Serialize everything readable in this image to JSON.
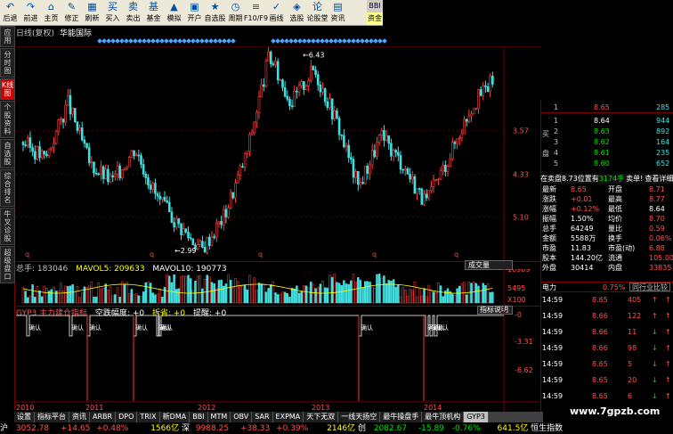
{
  "toolbar": {
    "buttons": [
      {
        "icon": "↶",
        "label": "后退",
        "name": "back"
      },
      {
        "icon": "↷",
        "label": "前进",
        "name": "forward"
      },
      {
        "icon": "⌂",
        "label": "主页",
        "name": "home"
      },
      {
        "icon": "✎",
        "label": "修正",
        "name": "edit"
      },
      {
        "icon": "▦",
        "label": "刷新",
        "name": "refresh"
      },
      {
        "icon": "买",
        "label": "买入",
        "name": "buy"
      },
      {
        "icon": "卖",
        "label": "卖出",
        "name": "sell"
      },
      {
        "icon": "基",
        "label": "基金",
        "name": "fund"
      },
      {
        "icon": "▲",
        "label": "模拟",
        "name": "simulate"
      },
      {
        "icon": "▣",
        "label": "开户",
        "name": "open-account"
      },
      {
        "icon": "★",
        "label": "自选股",
        "name": "watchlist"
      },
      {
        "icon": "◷",
        "label": "周期",
        "name": "period"
      },
      {
        "icon": "≡",
        "label": "F10/F9",
        "name": "f10"
      },
      {
        "icon": "✓",
        "label": "画线",
        "name": "draw"
      },
      {
        "icon": "◈",
        "label": "选股",
        "name": "stock-pick"
      },
      {
        "icon": "论",
        "label": "论股堂",
        "name": "forum"
      },
      {
        "icon": "▤",
        "label": "资讯",
        "name": "news"
      }
    ],
    "corner": "BBI",
    "top_right": "资金"
  },
  "sidebar": [
    "应用",
    "分时图",
    "K线图",
    "个股资料",
    "自选股",
    "综合排名",
    "牛叉诊股",
    "超级盘口"
  ],
  "chart_title": {
    "name": "日线(复权)",
    "stock": "华能国际"
  },
  "price_axis": [
    "5.10",
    "4.33",
    "3.57"
  ],
  "high_label": "6.43",
  "low_label": "2.99",
  "volume_header": {
    "total": "总手: 183046",
    "mavol5": "MAVOL5: 209633",
    "mavol10": "MAVOL10: 190773",
    "button": "成交量"
  },
  "volume_axis": [
    "10989",
    "5495",
    "X100"
  ],
  "indicator_header": {
    "name": "GYP3 主力建仓指标",
    "a": "空跌幅度: +0",
    "b": "拆省: +0",
    "c": "提醒: +0",
    "button": "指标说明"
  },
  "indicator_axis": [
    "-0",
    "-3.31",
    "-6.62"
  ],
  "indicator_markers": [
    "确认",
    "确认",
    "确认",
    "确认",
    "确认",
    "确认",
    "确认",
    "确认",
    "确认",
    "确认"
  ],
  "years": [
    "2010",
    "2011",
    "2012",
    "2013",
    "2014"
  ],
  "order_book": {
    "sell": [
      {
        "lvl": "1",
        "p": "8.65",
        "v": "285"
      }
    ],
    "buy": [
      {
        "lvl": "1",
        "p": "8.64",
        "v": "944"
      },
      {
        "lvl": "2",
        "p": "8.63",
        "v": "892"
      },
      {
        "lvl": "3",
        "p": "8.62",
        "v": "164"
      },
      {
        "lvl": "4",
        "p": "8.61",
        "v": "235"
      },
      {
        "lvl": "5",
        "p": "8.60",
        "v": "652"
      }
    ],
    "side_a": "买",
    "side_b": "盘"
  },
  "order_note": {
    "a": "在卖盘8.73位置有",
    "b": "3174手",
    "c": "卖单!",
    "d": "查看详细"
  },
  "quote": [
    [
      "最新",
      "8.65",
      "开盘",
      "8.71"
    ],
    [
      "涨跌",
      "+0.01",
      "最高",
      "8.77"
    ],
    [
      "涨幅",
      "+0.12%",
      "最低",
      "8.64"
    ],
    [
      "振幅",
      "1.50%",
      "均价",
      "8.70"
    ],
    [
      "总手",
      "64249",
      "量比",
      "0.59"
    ],
    [
      "金额",
      "5588万",
      "换手",
      "0.06%"
    ],
    [
      "市盈",
      "11.83",
      "市盈(动)",
      "6.88"
    ],
    [
      "股本",
      "144.20亿",
      "流通",
      "105.00亿"
    ],
    [
      "外盘",
      "30414",
      "内盘",
      "33835"
    ]
  ],
  "industry": {
    "name": "电力",
    "pct": "0.75%",
    "link": "同行业比较"
  },
  "trades": [
    [
      "14:59",
      "8.65",
      "405",
      "",
      ""
    ],
    [
      "14:59",
      "8.66",
      "122",
      "",
      ""
    ],
    [
      "14:59",
      "8.66",
      "11",
      "",
      ""
    ],
    [
      "14:59",
      "8.66",
      "98",
      "",
      ""
    ],
    [
      "14:59",
      "8.65",
      "5",
      "",
      ""
    ],
    [
      "14:59",
      "8.65",
      "20",
      "",
      ""
    ],
    [
      "14:59",
      "8.65",
      "6",
      "",
      ""
    ]
  ],
  "tabs": [
    "设置",
    "指标平台",
    "资讯",
    "ARBR",
    "DPO",
    "TRIX",
    "新DMA",
    "BBI",
    "MTM",
    "OBV",
    "SAR",
    "EXPMA",
    "天下无双",
    "一线天扬空",
    "最牛操盘手",
    "最牛顶机构",
    "GYP3"
  ],
  "status": {
    "a": "沪",
    "b": "3052.78",
    "c": "+14.65",
    "d": "+0.48%",
    "e": "1566亿",
    "f": "深",
    "g": "9988.25",
    "h": "+38.33",
    "i": "+0.39%",
    "j": "2146亿",
    "k": "创",
    "l": "2082.67",
    "m": "-15.89",
    "n": "-0.76%",
    "o": "641.5亿",
    "p": "恒生指数"
  },
  "watermark": "www.7gpzb.com",
  "chart_data": {
    "type": "candlestick",
    "stock": "华能国际",
    "period": "日线(复权)",
    "x": [
      "2010",
      "2011",
      "2012",
      "2013",
      "2014"
    ],
    "price_points": [
      4.9,
      4.6,
      5.6,
      4.5,
      4.2,
      4.8,
      3.9,
      3.4,
      2.99,
      3.6,
      4.7,
      6.43,
      5.6,
      6.2,
      5.3,
      4.1,
      5.0,
      4.5,
      3.8,
      4.6,
      5.5,
      6.0
    ],
    "ylim": [
      2.8,
      6.6
    ],
    "ticks": [
      3.57,
      4.33,
      5.1
    ]
  }
}
